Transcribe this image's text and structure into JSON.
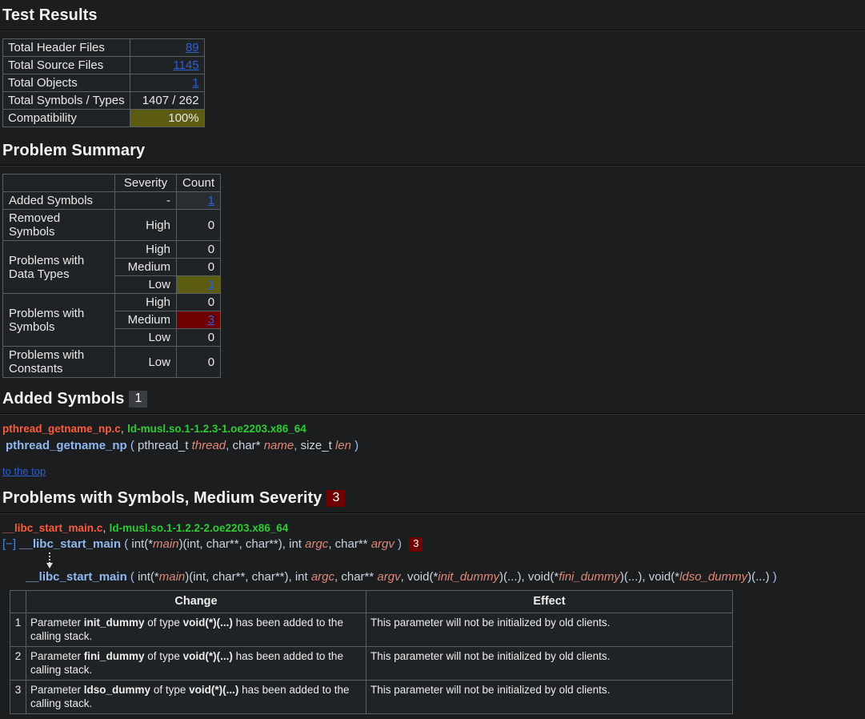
{
  "sections": {
    "test_results_title": "Test Results",
    "problem_summary_title": "Problem Summary",
    "added_symbols_title": "Added Symbols",
    "added_symbols_count": "1",
    "problems_symbols_title": "Problems with Symbols, Medium Severity",
    "problems_symbols_count": "3"
  },
  "test_results": {
    "rows": [
      {
        "label": "Total Header Files",
        "value": "89",
        "link": true,
        "highlight": "none"
      },
      {
        "label": "Total Source Files",
        "value": "1145",
        "link": true,
        "highlight": "none"
      },
      {
        "label": "Total Objects",
        "value": "1",
        "link": true,
        "highlight": "none"
      },
      {
        "label": "Total Symbols / Types",
        "value": "1407 / 262",
        "link": false,
        "highlight": "none"
      },
      {
        "label": "Compatibility",
        "value": "100%",
        "link": false,
        "highlight": "olive"
      }
    ]
  },
  "problem_summary": {
    "headers": [
      "",
      "Severity",
      "Count"
    ],
    "rows": [
      {
        "category": "Added Symbols",
        "severity": "-",
        "count": "1",
        "link": true,
        "highlight": "lighter"
      },
      {
        "category": "Removed Symbols",
        "severity": "High",
        "count": "0",
        "link": false,
        "highlight": "none"
      },
      {
        "category": "Problems with Data Types",
        "severity": "High",
        "count": "0",
        "link": false,
        "highlight": "none"
      },
      {
        "category": "",
        "severity": "Medium",
        "count": "0",
        "link": false,
        "highlight": "none"
      },
      {
        "category": "",
        "severity": "Low",
        "count": "1",
        "link": true,
        "highlight": "olive"
      },
      {
        "category": "Problems with Symbols",
        "severity": "High",
        "count": "0",
        "link": false,
        "highlight": "none"
      },
      {
        "category": "",
        "severity": "Medium",
        "count": "3",
        "link": true,
        "highlight": "red"
      },
      {
        "category": "",
        "severity": "Low",
        "count": "0",
        "link": false,
        "highlight": "none"
      },
      {
        "category": "Problems with Constants",
        "severity": "Low",
        "count": "0",
        "link": false,
        "highlight": "none"
      }
    ],
    "cat_labels": {
      "added": "Added Symbols",
      "removed": "Removed Symbols",
      "datatypes_l1": "Problems with",
      "datatypes_l2": "Data Types",
      "symbols_l1": "Problems with",
      "symbols_l2": "Symbols",
      "constants_l1": "Problems with",
      "constants_l2": "Constants"
    }
  },
  "added_symbols": {
    "source_file": "pthread_getname_np.c",
    "separator": ",",
    "library": "ld-musl.so.1-1.2.3-1.oe2203.x86_64",
    "signature": {
      "name": "pthread_getname_np",
      "open": "(",
      "params": [
        {
          "type": "pthread_t",
          "name": "thread"
        },
        {
          "type": "char*",
          "name": "name"
        },
        {
          "type": "size_t",
          "name": "len"
        }
      ],
      "close": ")"
    },
    "to_the_top": "to the top"
  },
  "problems_symbols": {
    "source_file": "__libc_start_main.c",
    "separator": ",",
    "library": "ld-musl.so.1-1.2.2-2.oe2203.x86_64",
    "toggle": "[−]",
    "old_signature": {
      "name": "__libc_start_main",
      "open": "(",
      "parts": [
        {
          "type": "int(*",
          "name": "main",
          "tail": ")(int, char**, char**),"
        },
        {
          "type": "int",
          "name": "argc",
          "tail": ","
        },
        {
          "type": "char**",
          "name": "argv",
          "tail": ""
        }
      ],
      "close": ")"
    },
    "old_signature_count": "3",
    "new_signature": {
      "name": "__libc_start_main",
      "open": "(",
      "parts": [
        {
          "type": "int(*",
          "name": "main",
          "tail": ")(int, char**, char**),"
        },
        {
          "type": "int",
          "name": "argc",
          "tail": ","
        },
        {
          "type": "char**",
          "name": "argv",
          "tail": ","
        },
        {
          "type": "void(*",
          "name": "init_dummy",
          "tail": ")(...),"
        },
        {
          "type": "void(*",
          "name": "fini_dummy",
          "tail": ")(...),"
        },
        {
          "type": "void(*",
          "name": "ldso_dummy",
          "tail": ")(...)"
        }
      ],
      "close": ")"
    },
    "table": {
      "headers": {
        "index": "",
        "change": "Change",
        "effect": "Effect"
      },
      "rows": [
        {
          "index": "1",
          "change_pre": "Parameter ",
          "change_param": "init_dummy",
          "change_mid": " of type ",
          "change_type": "void(*)(...)",
          "change_post": " has been added to the calling stack.",
          "effect": "This parameter will not be initialized by old clients."
        },
        {
          "index": "2",
          "change_pre": "Parameter ",
          "change_param": "fini_dummy",
          "change_mid": " of type ",
          "change_type": "void(*)(...)",
          "change_post": " has been added to the calling stack.",
          "effect": "This parameter will not be initialized by old clients."
        },
        {
          "index": "3",
          "change_pre": "Parameter ",
          "change_param": "ldso_dummy",
          "change_mid": " of type ",
          "change_type": "void(*)(...)",
          "change_post": " has been added to the calling stack.",
          "effect": "This parameter will not be initialized by old clients."
        }
      ]
    }
  }
}
